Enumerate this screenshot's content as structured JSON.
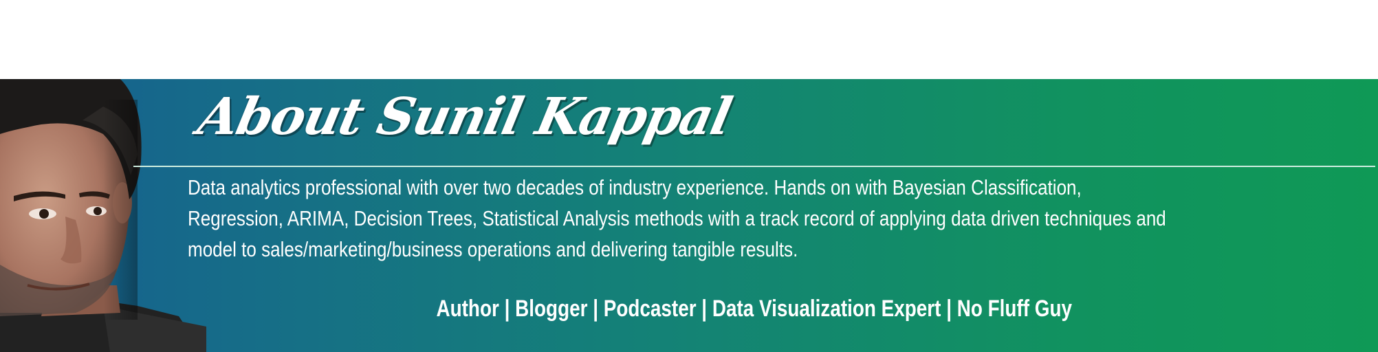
{
  "banner": {
    "title": "About Sunil Kappal",
    "description": "Data analytics professional with over two decades of industry experience. Hands on with Bayesian Classification, Regression, ARIMA, Decision Trees, Statistical Analysis methods with a track record of applying data driven techniques and model to sales/marketing/business operations and delivering tangible results.",
    "tagline": "Author | Blogger | Podcaster | Data Visualization Expert | No Fluff Guy"
  },
  "colors": {
    "gradient_start": "#175e90",
    "gradient_end": "#0f9956",
    "text": "#ffffff"
  }
}
